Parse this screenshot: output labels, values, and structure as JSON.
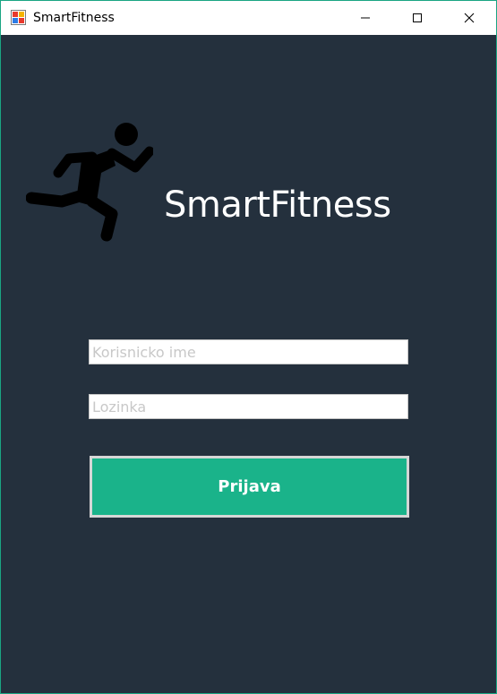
{
  "window": {
    "title": "SmartFitness",
    "app_icon": "windows-form-icon",
    "controls": {
      "minimize_icon": "minimize-icon",
      "maximize_icon": "maximize-icon",
      "close_icon": "close-icon"
    }
  },
  "branding": {
    "logo_icon": "running-person-icon",
    "title": "SmartFitness"
  },
  "login_form": {
    "username_placeholder": "Korisnicko ime",
    "password_placeholder": "Lozinka",
    "submit_label": "Prijava"
  },
  "colors": {
    "background": "#24303d",
    "accent": "#1ab38a",
    "window_border": "#1aa583",
    "button_border": "#d6d6d6",
    "title_text": "#ffffff"
  }
}
